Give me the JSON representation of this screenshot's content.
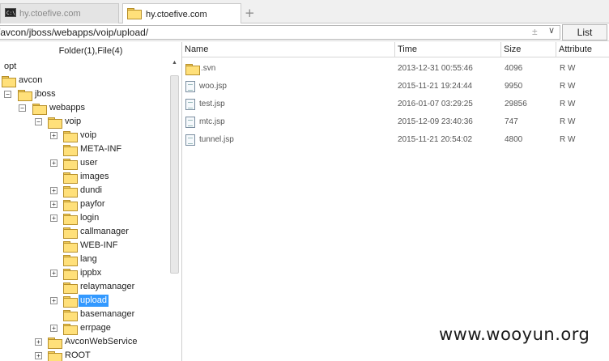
{
  "tabs": [
    {
      "label": "hy.ctoefive.com",
      "icon": "terminal-icon",
      "active": false
    },
    {
      "label": "hy.ctoefive.com",
      "icon": "folder-icon",
      "active": true
    }
  ],
  "new_tab_symbol": "+",
  "address": {
    "value": "/avcon/jboss/webapps/voip/upload/",
    "plusminus_symbol": "±",
    "dropdown_symbol": "∨",
    "list_button": "List"
  },
  "left_panel": {
    "header": "Folder(1),File(4)",
    "tree": [
      {
        "label": "opt",
        "level": 0,
        "expander": "",
        "folder": false
      },
      {
        "label": "avcon",
        "level": 0,
        "expander": "",
        "folder": true
      },
      {
        "label": "jboss",
        "level": 1,
        "expander": "−",
        "folder": true
      },
      {
        "label": "webapps",
        "level": 2,
        "expander": "−",
        "folder": true
      },
      {
        "label": "voip",
        "level": 3,
        "expander": "−",
        "folder": true
      },
      {
        "label": "voip",
        "level": 4,
        "expander": "+",
        "folder": true
      },
      {
        "label": "META-INF",
        "level": 4,
        "expander": "",
        "folder": true
      },
      {
        "label": "user",
        "level": 4,
        "expander": "+",
        "folder": true
      },
      {
        "label": "images",
        "level": 4,
        "expander": "",
        "folder": true
      },
      {
        "label": "dundi",
        "level": 4,
        "expander": "+",
        "folder": true
      },
      {
        "label": "payfor",
        "level": 4,
        "expander": "+",
        "folder": true
      },
      {
        "label": "login",
        "level": 4,
        "expander": "+",
        "folder": true
      },
      {
        "label": "callmanager",
        "level": 4,
        "expander": "",
        "folder": true
      },
      {
        "label": "WEB-INF",
        "level": 4,
        "expander": "",
        "folder": true
      },
      {
        "label": "lang",
        "level": 4,
        "expander": "",
        "folder": true
      },
      {
        "label": "ippbx",
        "level": 4,
        "expander": "+",
        "folder": true
      },
      {
        "label": "relaymanager",
        "level": 4,
        "expander": "",
        "folder": true
      },
      {
        "label": "upload",
        "level": 4,
        "expander": "+",
        "folder": true,
        "selected": true
      },
      {
        "label": "basemanager",
        "level": 4,
        "expander": "",
        "folder": true
      },
      {
        "label": "errpage",
        "level": 4,
        "expander": "+",
        "folder": true
      },
      {
        "label": "AvconWebService",
        "level": 3,
        "expander": "+",
        "folder": true
      },
      {
        "label": "ROOT",
        "level": 3,
        "expander": "+",
        "folder": true
      }
    ]
  },
  "file_table": {
    "columns": [
      "Name",
      "Time",
      "Size",
      "Attribute"
    ],
    "rows": [
      {
        "name": ".svn",
        "time": "2013-12-31 00:55:46",
        "size": "4096",
        "attr": "R W",
        "type": "folder"
      },
      {
        "name": "woo.jsp",
        "time": "2015-11-21 19:24:44",
        "size": "9950",
        "attr": "R W",
        "type": "file"
      },
      {
        "name": "test.jsp",
        "time": "2016-01-07 03:29:25",
        "size": "29856",
        "attr": "R W",
        "type": "file"
      },
      {
        "name": "mtc.jsp",
        "time": "2015-12-09 23:40:36",
        "size": "747",
        "attr": "R W",
        "type": "file"
      },
      {
        "name": "tunnel.jsp",
        "time": "2015-11-21 20:54:02",
        "size": "4800",
        "attr": "R W",
        "type": "file"
      }
    ]
  },
  "watermark": "www.wooyun.org",
  "colors": {
    "selection": "#3399ff",
    "folder": "#ffe07a"
  }
}
